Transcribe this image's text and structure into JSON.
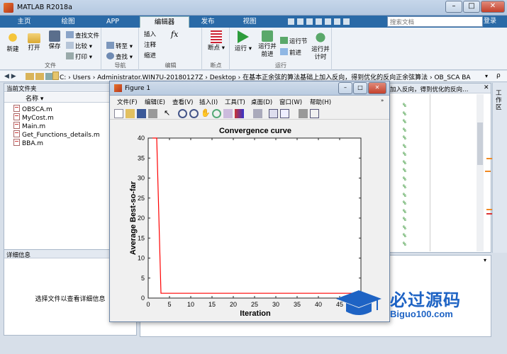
{
  "window": {
    "title": "MATLAB R2018a"
  },
  "ribbon_tabs": [
    "主页",
    "绘图",
    "APP",
    "编辑器",
    "发布",
    "视图"
  ],
  "search": {
    "placeholder": "搜索文档"
  },
  "login": "登录",
  "ribbon": {
    "file": {
      "new": "新建",
      "open": "打开",
      "save": "保存",
      "find_files": "查找文件",
      "compare": "比较",
      "print": "打印",
      "label": "文件"
    },
    "navigate": {
      "goto": "转至",
      "find": "查找",
      "label": "导航"
    },
    "edit": {
      "insert": "插入",
      "comment": "注释",
      "indent": "缩进",
      "fx": "fx",
      "label": "编辑"
    },
    "breakpoints": {
      "bp": "断点",
      "label": "断点"
    },
    "run": {
      "run": "运行",
      "run_advance": "运行并\n前进",
      "run_section": "运行节",
      "advance": "前进",
      "run_time": "运行并\n计时",
      "label": "运行"
    }
  },
  "address": {
    "path": "C:  ›  Users  ›  Administrator.WIN7U-20180127Z  ›  Desktop  ›  在基本正余弦的算法基础上加入反向，得到优化的反向正余弦算法  ›  OB_SCA BA"
  },
  "current_folder": {
    "title": "当前文件夹",
    "col_name": "名称 ▾",
    "files": [
      "OBSCA.m",
      "MyCost.m",
      "Main.m",
      "Get_Functions_details.m",
      "BBA.m"
    ]
  },
  "details": {
    "title": "详细信息",
    "message": "选择文件以查看详细信息"
  },
  "editor": {
    "tab_text": "加入反向，得到优化的反向…",
    "workspace": "工作区",
    "comment_marks": [
      "%",
      "%",
      "%",
      "%",
      "%",
      "%",
      "%",
      "%",
      "%",
      "%",
      "%",
      "%",
      "%",
      "%",
      "%",
      "%",
      "%",
      "%"
    ]
  },
  "figure": {
    "title": "Figure 1",
    "menu": [
      "文件(F)",
      "编辑(E)",
      "查看(V)",
      "插入(I)",
      "工具(T)",
      "桌面(D)",
      "窗口(W)",
      "帮助(H)"
    ]
  },
  "chart_data": {
    "type": "line",
    "title": "Convergence curve",
    "xlabel": "Iteration",
    "ylabel": "Average Best-so-far",
    "xlim": [
      0,
      50
    ],
    "ylim": [
      0,
      40
    ],
    "xticks": [
      0,
      5,
      10,
      15,
      20,
      25,
      30,
      35,
      40,
      45
    ],
    "yticks": [
      0,
      5,
      10,
      15,
      20,
      25,
      30,
      35,
      40
    ],
    "grid": false,
    "series": [
      {
        "color": "#ff0000",
        "x": [
          1,
          2,
          3,
          4,
          5,
          10,
          20,
          30,
          40,
          50
        ],
        "y": [
          40,
          40,
          1.2,
          1.2,
          1.2,
          1.2,
          1.2,
          1.2,
          1.2,
          1.2
        ]
      }
    ]
  },
  "watermark": {
    "cn": "必过源码",
    "en": "Biguo100.com"
  }
}
